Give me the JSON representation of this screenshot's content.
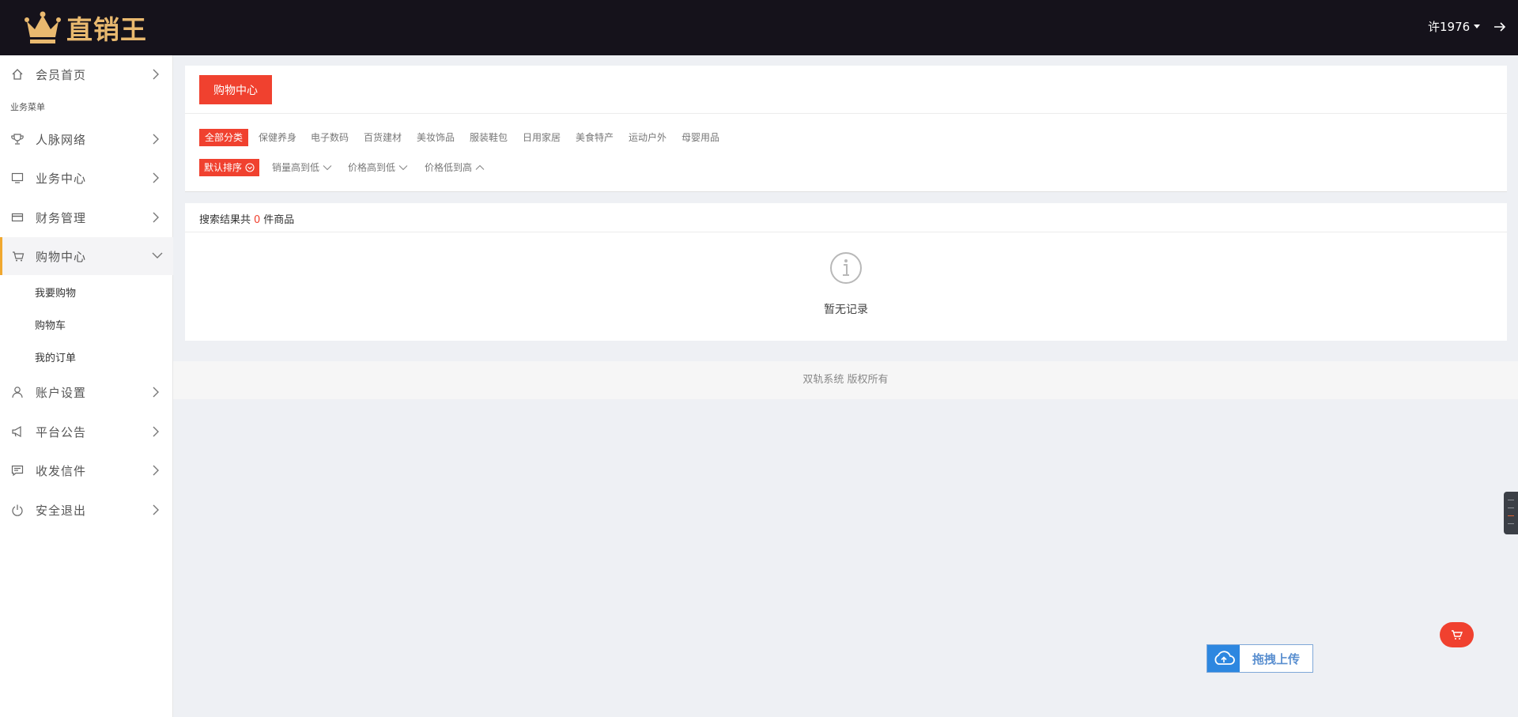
{
  "brand": {
    "name": "直销王",
    "accent_color": "#e9b96f"
  },
  "header": {
    "username": "许1976"
  },
  "sidebar": {
    "home": {
      "label": "会员首页",
      "icon": "home-icon"
    },
    "section_label": "业务菜单",
    "items": [
      {
        "label": "人脉网络",
        "icon": "trophy-icon"
      },
      {
        "label": "业务中心",
        "icon": "monitor-icon"
      },
      {
        "label": "财务管理",
        "icon": "card-icon"
      },
      {
        "label": "购物中心",
        "icon": "cart-icon",
        "expanded": true
      },
      {
        "label": "账户设置",
        "icon": "user-icon"
      },
      {
        "label": "平台公告",
        "icon": "megaphone-icon"
      },
      {
        "label": "收发信件",
        "icon": "message-icon"
      },
      {
        "label": "安全退出",
        "icon": "power-icon"
      }
    ],
    "submenu": [
      "我要购物",
      "购物车",
      "我的订单"
    ]
  },
  "shop": {
    "tab_label": "购物中心",
    "categories": [
      "全部分类",
      "保健养身",
      "电子数码",
      "百货建材",
      "美妆饰品",
      "服装鞋包",
      "日用家居",
      "美食特产",
      "运动户外",
      "母婴用品"
    ],
    "sorts": [
      "默认排序",
      "销量高到低",
      "价格高到低",
      "价格低到高"
    ],
    "active_color": "#f0412f"
  },
  "results": {
    "prefix": "搜索结果共",
    "count": "0",
    "suffix": "件商品",
    "empty_text": "暂无记录"
  },
  "footer": {
    "text": "双轨系统 版权所有"
  },
  "upload": {
    "label": "拖拽上传"
  }
}
